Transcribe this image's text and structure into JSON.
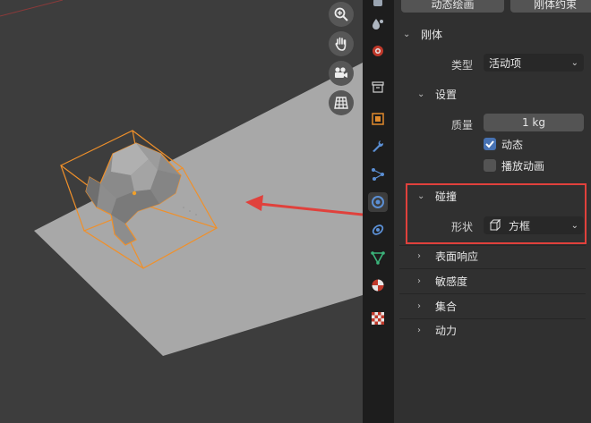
{
  "panel": {
    "top_buttons": [
      "动态绘画",
      "刚体约束"
    ],
    "rigid_body": {
      "title": "刚体",
      "type_label": "类型",
      "type_value": "活动项"
    },
    "settings": {
      "title": "设置",
      "mass_label": "质量",
      "mass_value": "1 kg",
      "dynamic_label": "动态",
      "dynamic_checked": true,
      "animated_label": "播放动画",
      "animated_checked": false
    },
    "collisions": {
      "title": "碰撞",
      "shape_label": "形状",
      "shape_value": "方框",
      "shape_icon": "box-shape-icon"
    },
    "collapsed_sections": [
      "表面响应",
      "敏感度",
      "集合",
      "动力"
    ]
  },
  "viewport": {
    "nav_icons": [
      "zoom-icon",
      "hand-pan-icon",
      "camera-icon",
      "grid-icon"
    ]
  },
  "tabs": [
    "particles-icon",
    "physics-icon",
    "object-data-icon",
    "output-icon",
    "object-icon",
    "modifier-icon",
    "particles-icon",
    "physics-active-icon",
    "constraint-icon",
    "data-icon",
    "material-icon",
    "texture-icon"
  ],
  "colors": {
    "accent_blue": "#4772b3",
    "selection_orange": "#f0902a",
    "annotation_red": "#e0413c"
  }
}
